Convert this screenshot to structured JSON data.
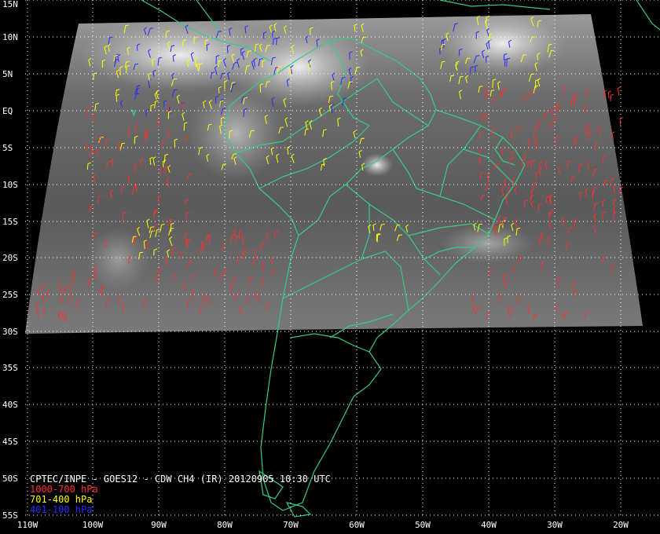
{
  "title": "CPTEC/INPE - GOES12 - CDW CH4 (IR) 20120905 10:30 UTC",
  "legend": [
    {
      "label": "1000-700 hPa",
      "color": "#ff3030"
    },
    {
      "label": "701-400 hPa",
      "color": "#ffff00"
    },
    {
      "label": "401-100 hPa",
      "color": "#2a2aff"
    }
  ],
  "lat_labels": [
    "15N",
    "10N",
    "5N",
    "EQ",
    "5S",
    "10S",
    "15S",
    "20S",
    "25S",
    "30S",
    "35S",
    "40S",
    "45S",
    "50S",
    "55S"
  ],
  "lon_labels": [
    "110W",
    "100W",
    "90W",
    "80W",
    "70W",
    "60W",
    "50W",
    "40W",
    "30W",
    "20W"
  ],
  "colors": {
    "coastline": "#33cc88",
    "grid": "#ffffff",
    "background": "#000000"
  }
}
